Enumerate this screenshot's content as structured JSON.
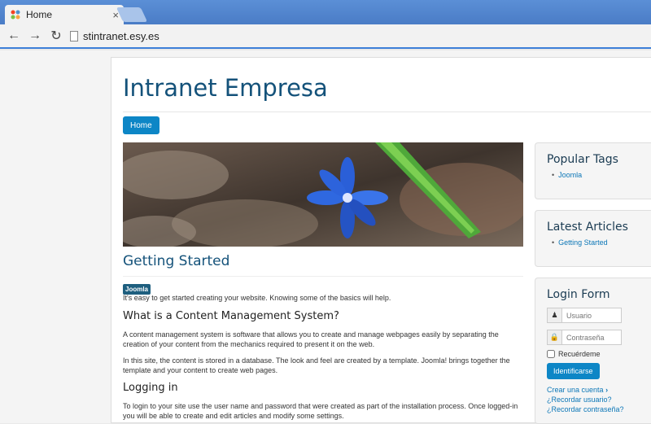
{
  "browser": {
    "tab_title": "Home",
    "tab_close": "×",
    "url": "stintranet.esy.es"
  },
  "site": {
    "brand": "Intranet Empresa",
    "menu_home": "Home"
  },
  "article": {
    "title": "Getting Started",
    "tag": "Joomla",
    "intro": "It's easy to get started creating your website. Knowing some of the basics will help.",
    "h_cms": "What is a Content Management System?",
    "p_cms": "A content management system is software that allows you to create and manage webpages easily by separating the creation of your content from the mechanics required to present it on the web.",
    "p_site": "In this site, the content is stored in a database. The look and feel are created by a template. Joomla! brings together the template and your content to create web pages.",
    "h_login": "Logging in",
    "p_login": "To login to your site use the user name and password that were created as part of the installation process. Once logged-in you will be able to create and edit articles and modify some settings."
  },
  "sidebar": {
    "popular_tags_title": "Popular Tags",
    "popular_tags": [
      "Joomla"
    ],
    "latest_title": "Latest Articles",
    "latest_articles": [
      "Getting Started"
    ],
    "login_title": "Login Form",
    "username_placeholder": "Usuario",
    "password_placeholder": "Contraseña",
    "remember_label": "Recuérdeme",
    "login_button": "Identificarse",
    "create_account": "Crear una cuenta",
    "forgot_user": "¿Recordar usuario?",
    "forgot_pass": "¿Recordar contraseña?"
  }
}
